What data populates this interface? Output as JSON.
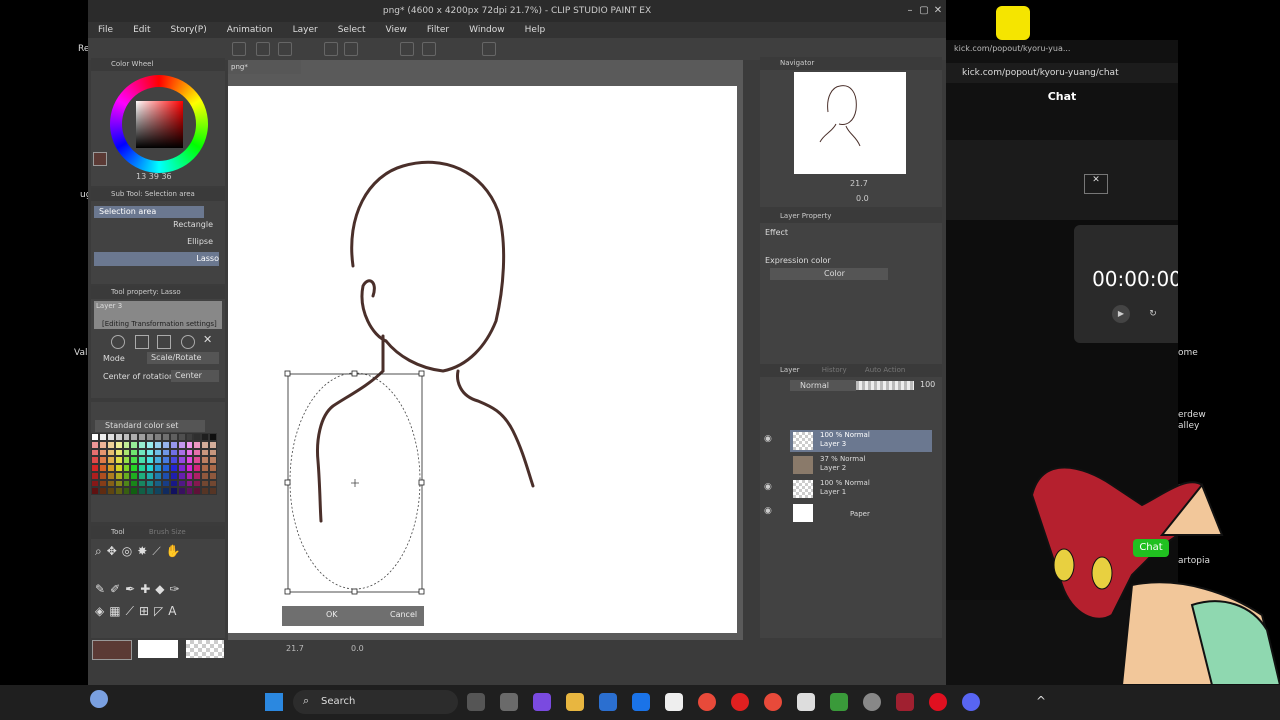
{
  "csp": {
    "title": "png* (4600 x 4200px 72dpi 21.7%) - CLIP STUDIO PAINT EX",
    "menu": [
      "File",
      "Edit",
      "Story(P)",
      "Animation",
      "Layer",
      "Select",
      "View",
      "Filter",
      "Window",
      "Help"
    ],
    "doc_tab": "png*",
    "color_wheel": {
      "header": "Color Wheel",
      "values": "13  39  36",
      "main_color": "#5b3a35"
    },
    "sub_tool": {
      "header": "Sub Tool: Selection area",
      "active": "Selection area",
      "items": [
        "Rectangle",
        "Ellipse",
        "Lasso"
      ]
    },
    "tool_property": {
      "header": "Tool property: Lasso",
      "layer_hint": "Layer 3",
      "editing_label": "[Editing Transformation settings]",
      "mode_label": "Mode",
      "mode_value": "Scale/Rotate",
      "center_label": "Center of rotation",
      "center_value": "Center"
    },
    "color_set": {
      "name": "Standard color set"
    },
    "tool_panel": {
      "tab": "Tool",
      "tab2": "Brush Size"
    },
    "navigator": {
      "header": "Navigator",
      "zoom": "21.7",
      "angle": "0.0"
    },
    "layer_property": {
      "header": "Layer Property",
      "effect_label": "Effect",
      "expression_label": "Expression color",
      "expression_value": "Color"
    },
    "layer_panel": {
      "tabs": [
        "Layer",
        "History",
        "Auto Action"
      ],
      "blend_mode": "Normal",
      "opacity": "100",
      "layers": [
        {
          "line1": "100 % Normal",
          "line2": "Layer 3",
          "selected": true
        },
        {
          "line1": "37 % Normal",
          "line2": "Layer 2",
          "selected": false
        },
        {
          "line1": "100 % Normal",
          "line2": "Layer 1",
          "selected": false
        },
        {
          "line1": "",
          "line2": "Paper",
          "selected": false
        }
      ]
    },
    "transform": {
      "ok": "OK",
      "cancel": "Cancel"
    },
    "status": {
      "zoom": "21.7",
      "angle": "0.0"
    }
  },
  "browser": {
    "tab_url": "kick.com/popout/kyoru-yua...",
    "url": "kick.com/popout/kyoru-yuang/chat",
    "heading": "Chat",
    "timer": "00:00:00"
  },
  "desktop": {
    "chat_bubble": "Chat",
    "fragments": [
      "ome",
      "erdew",
      "alley",
      "ia",
      "artopia"
    ],
    "left_fragments": [
      "Re",
      "ug",
      "Val"
    ]
  },
  "taskbar": {
    "search_placeholder": "Search"
  }
}
